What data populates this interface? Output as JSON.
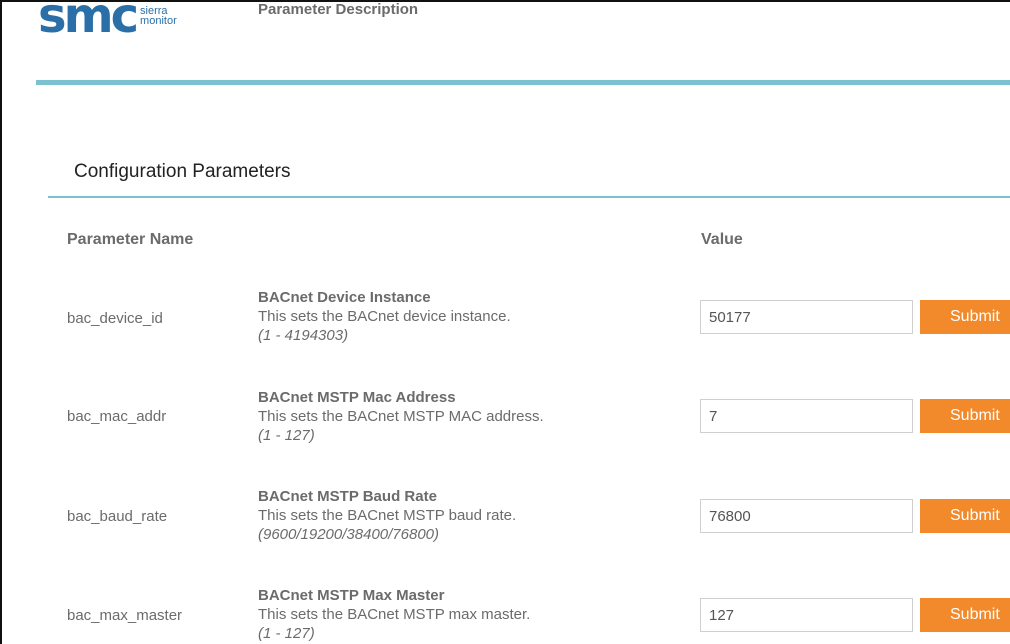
{
  "logo": {
    "mark": "smc",
    "line1": "sierra",
    "line2": "monitor",
    "color": "#2b6fa8"
  },
  "section": {
    "title": "Configuration Parameters"
  },
  "table": {
    "headers": {
      "name": "Parameter Name",
      "description": "Parameter Description",
      "value": "Value"
    },
    "rows": [
      {
        "name": "bac_device_id",
        "title": "BACnet Device Instance",
        "description": "This sets the BACnet device instance.",
        "range": "(1 - 4194303)",
        "value": "50177",
        "submit_label": "Submit"
      },
      {
        "name": "bac_mac_addr",
        "title": "BACnet MSTP Mac Address",
        "description": "This sets the BACnet MSTP MAC address.",
        "range": "(1 - 127)",
        "value": "7",
        "submit_label": "Submit"
      },
      {
        "name": "bac_baud_rate",
        "title": "BACnet MSTP Baud Rate",
        "description": "This sets the BACnet MSTP baud rate.",
        "range": "(9600/19200/38400/76800)",
        "value": "76800",
        "submit_label": "Submit"
      },
      {
        "name": "bac_max_master",
        "title": "BACnet MSTP Max Master",
        "description": "This sets the BACnet MSTP max master.",
        "range": "(1 - 127)",
        "value": "127",
        "submit_label": "Submit"
      }
    ]
  },
  "colors": {
    "accent_rule": "#7cc1cf",
    "submit": "#f28a2c",
    "text_muted": "#6b6b6b"
  }
}
